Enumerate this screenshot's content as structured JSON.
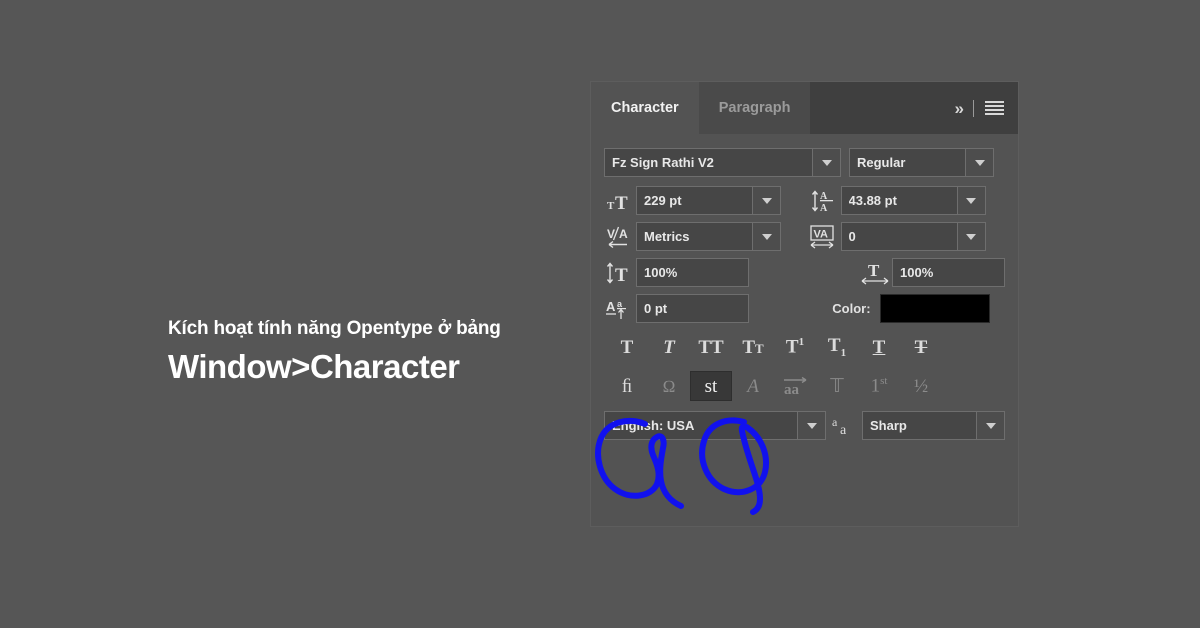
{
  "overlay": {
    "line1": "Kích hoạt tính năng Opentype ở bảng",
    "line2": "Window>Character"
  },
  "panel": {
    "tabs": [
      {
        "label": "Character",
        "active": true
      },
      {
        "label": "Paragraph",
        "active": false
      }
    ],
    "tools": {
      "collapse_label": "»",
      "menu_name": "panel-menu"
    },
    "font": {
      "family_value": "Fz Sign Rathi V2",
      "style_value": "Regular"
    },
    "metrics": {
      "size_icon": "font-size-icon",
      "size_value": "229 pt",
      "leading_icon": "leading-icon",
      "leading_value": "43.88 pt",
      "kerning_icon": "kerning-icon",
      "kerning_value": "Metrics",
      "tracking_icon": "tracking-icon",
      "tracking_value": "0",
      "vscale_icon": "vertical-scale-icon",
      "vscale_value": "100%",
      "hscale_icon": "horizontal-scale-icon",
      "hscale_value": "100%",
      "baseline_icon": "baseline-shift-icon",
      "baseline_value": "0 pt",
      "color_label": "Color:",
      "color_value": "#000000"
    },
    "style_buttons": [
      {
        "name": "faux-bold",
        "glyph": "T",
        "state": "normal"
      },
      {
        "name": "faux-italic",
        "glyph": "T",
        "state": "normal"
      },
      {
        "name": "all-caps",
        "glyph": "TT",
        "state": "normal"
      },
      {
        "name": "small-caps",
        "glyph": "Tт",
        "state": "normal"
      },
      {
        "name": "superscript",
        "glyph": "T1",
        "state": "normal"
      },
      {
        "name": "subscript",
        "glyph": "T1",
        "state": "normal"
      },
      {
        "name": "underline",
        "glyph": "T",
        "state": "normal"
      },
      {
        "name": "strikethrough",
        "glyph": "T",
        "state": "normal"
      }
    ],
    "opentype_buttons": [
      {
        "name": "standard-ligatures",
        "glyph": "fi",
        "state": "normal"
      },
      {
        "name": "contextual-alternates",
        "glyph": "℘",
        "state": "dim"
      },
      {
        "name": "discretionary-ligatures",
        "glyph": "st",
        "state": "active"
      },
      {
        "name": "swash",
        "glyph": "A",
        "state": "dim"
      },
      {
        "name": "stylistic-alternates",
        "glyph": "aa",
        "state": "dim"
      },
      {
        "name": "titling-alternates",
        "glyph": "T",
        "state": "dim"
      },
      {
        "name": "ordinals",
        "glyph": "1st",
        "state": "dim"
      },
      {
        "name": "fractions",
        "glyph": "½",
        "state": "dim"
      }
    ],
    "bottom": {
      "language_value": "English: USA",
      "antialias_icon": "anti-alias-icon",
      "antialias_value": "Sharp"
    }
  },
  "annotations": {
    "circle_1_target": "standard-ligatures",
    "circle_2_target": "discretionary-ligatures",
    "color": "#1111ee"
  },
  "colors": {
    "background": "#565656",
    "panel": "#535353",
    "tabbar": "#3f3f3f",
    "field": "#464646",
    "text": "#e8e8e8"
  }
}
